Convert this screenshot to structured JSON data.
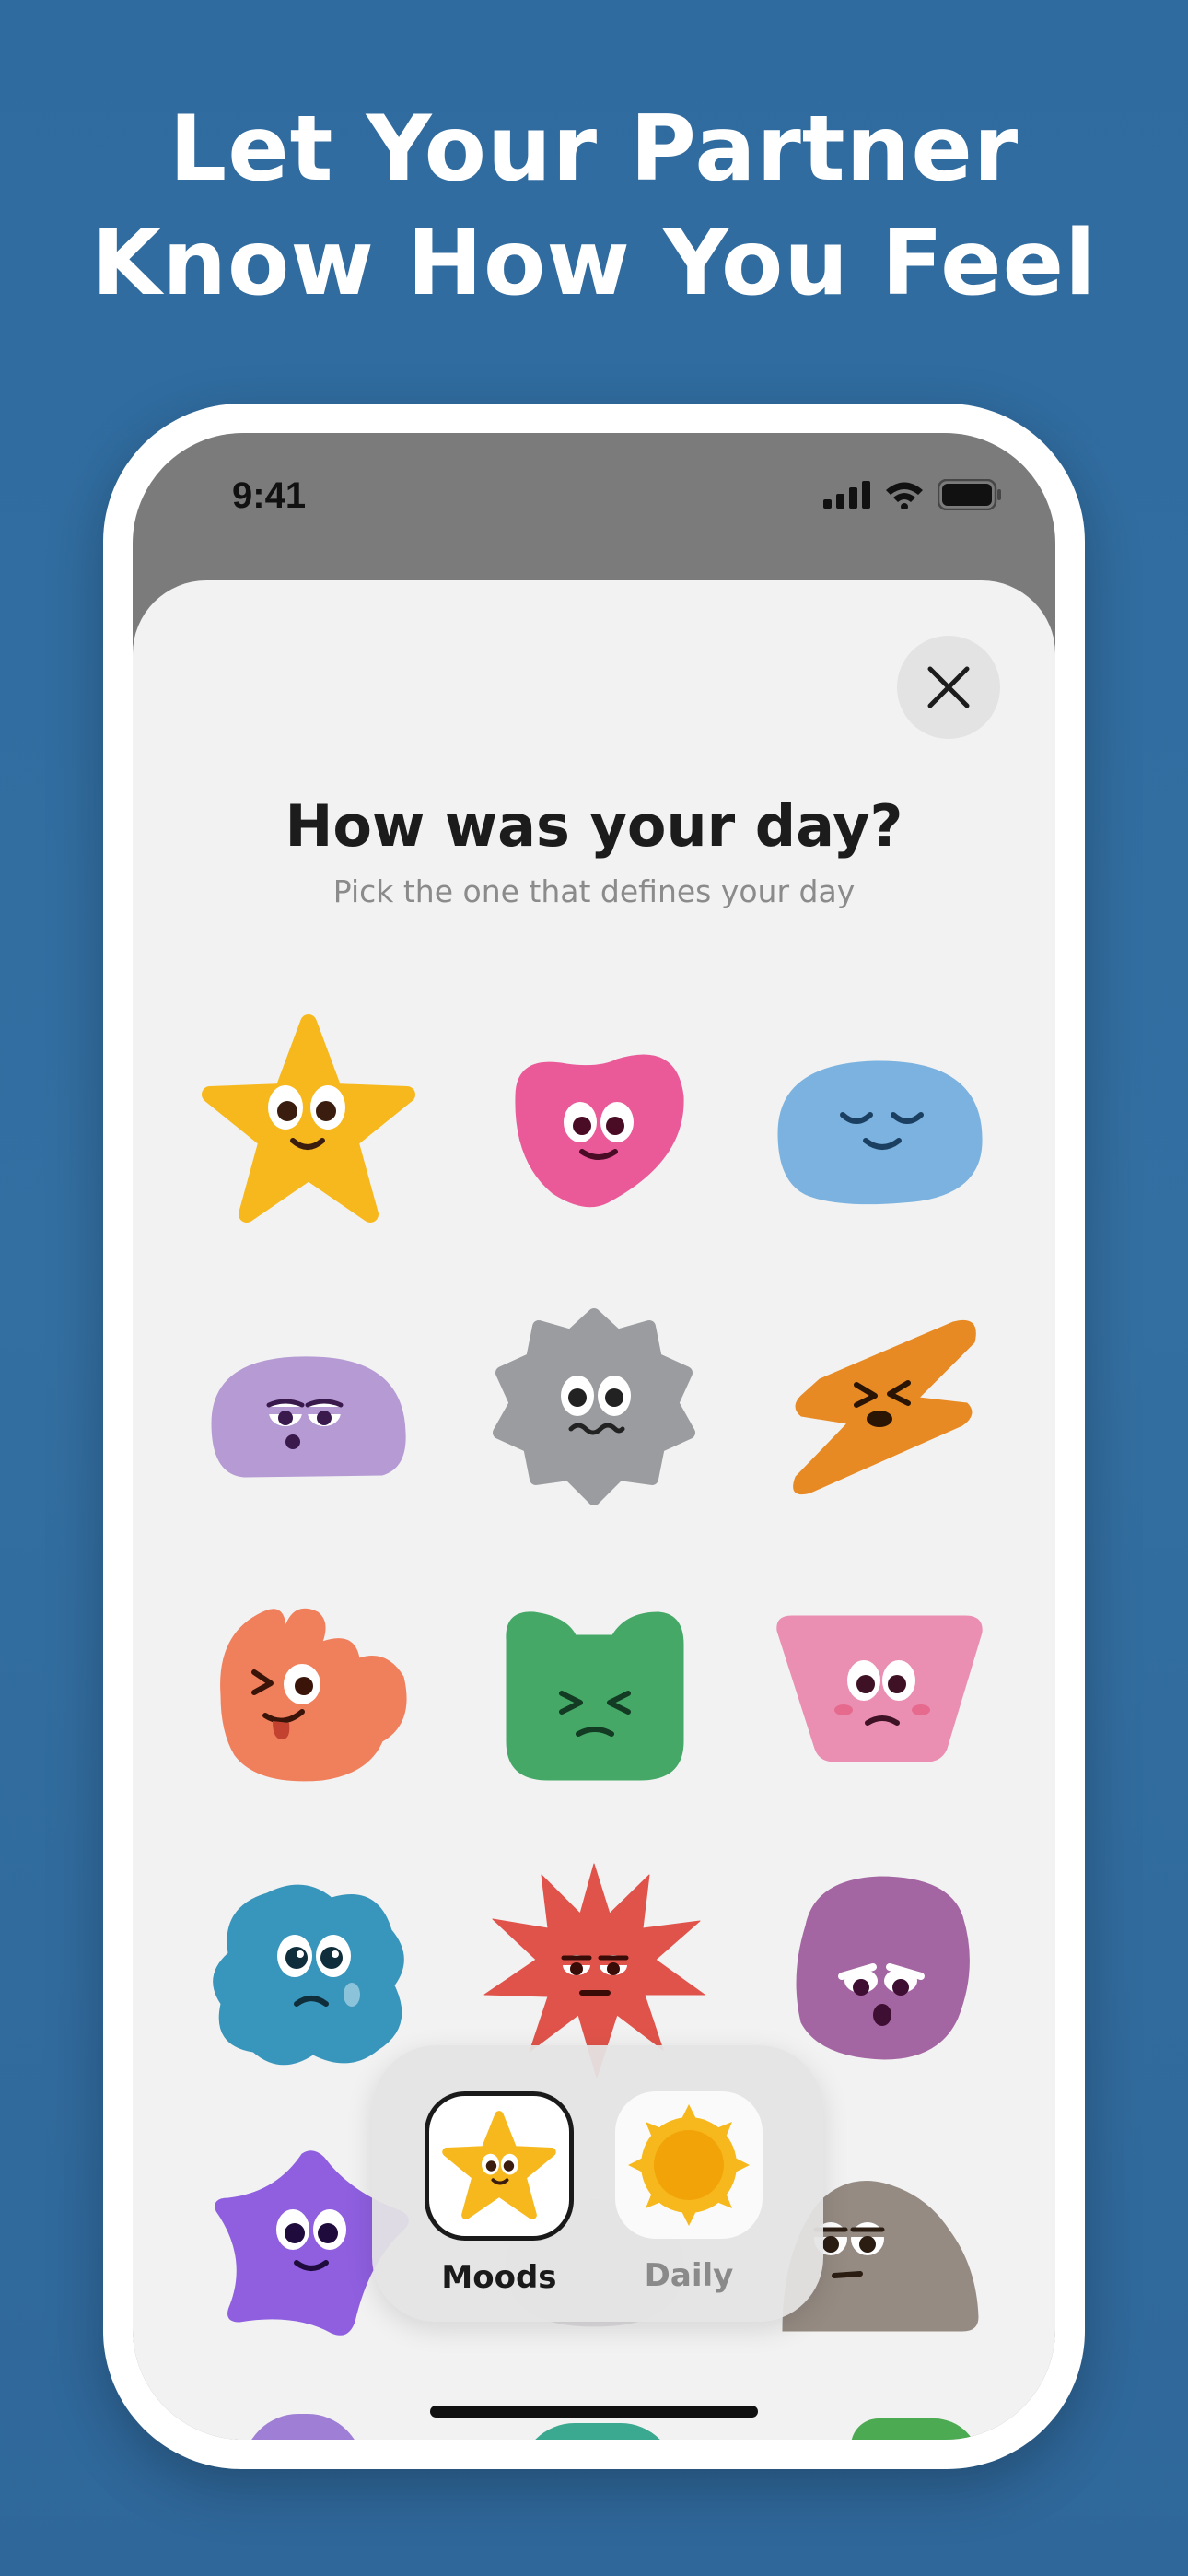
{
  "headline": {
    "line1": "Let Your Partner",
    "line2": "Know How You Feel"
  },
  "status_bar": {
    "time": "9:41"
  },
  "sheet": {
    "title": "How was your day?",
    "subtitle": "Pick the one that defines your day"
  },
  "moods": [
    {
      "shape": "star",
      "color": "#f6b81d",
      "face": "happy"
    },
    {
      "shape": "heart",
      "color": "#ea5a98",
      "face": "happy"
    },
    {
      "shape": "blob",
      "color": "#7bb2e0",
      "face": "calm"
    },
    {
      "shape": "blob",
      "color": "#b59ad4",
      "face": "tired"
    },
    {
      "shape": "gear",
      "color": "#9a9c9f",
      "face": "worried"
    },
    {
      "shape": "bolt",
      "color": "#e88a24",
      "face": "angry"
    },
    {
      "shape": "flower",
      "color": "#f07f5c",
      "face": "silly"
    },
    {
      "shape": "cat",
      "color": "#45a867",
      "face": "frustrated"
    },
    {
      "shape": "trapezoid",
      "color": "#ea8fb2",
      "face": "awkward"
    },
    {
      "shape": "cloud",
      "color": "#3895bb",
      "face": "sad"
    },
    {
      "shape": "burst",
      "color": "#e0534a",
      "face": "annoyed"
    },
    {
      "shape": "squircle",
      "color": "#a466a3",
      "face": "upset"
    },
    {
      "shape": "diamond",
      "color": "#8f5fe0",
      "face": "happy"
    },
    {
      "shape": "blob",
      "color": "#c0b8c4",
      "face": "none"
    },
    {
      "shape": "rock",
      "color": "#958b83",
      "face": "meh"
    }
  ],
  "tabs": [
    {
      "label": "Moods",
      "active": true,
      "icon": "star-mood-icon"
    },
    {
      "label": "Daily",
      "active": false,
      "icon": "sun-icon"
    }
  ],
  "colors": {
    "background": "#336fa1",
    "active_text": "#1a1a1a",
    "inactive_text": "#8a8a8a"
  }
}
